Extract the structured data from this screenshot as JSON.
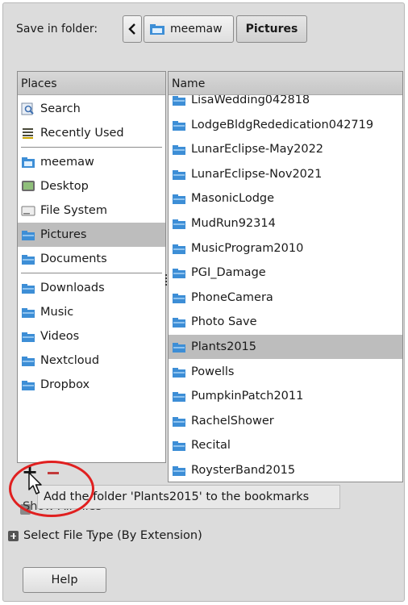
{
  "header": {
    "save_in_label": "Save in folder:",
    "path": [
      {
        "label": "meemaw",
        "icon": "home-folder-icon"
      },
      {
        "label": "Pictures",
        "icon": null
      }
    ]
  },
  "places": {
    "header": "Places",
    "groups": [
      [
        {
          "label": "Search",
          "icon": "search-icon"
        },
        {
          "label": "Recently Used",
          "icon": "recent-icon"
        }
      ],
      [
        {
          "label": "meemaw",
          "icon": "home-folder-icon"
        },
        {
          "label": "Desktop",
          "icon": "desktop-icon"
        },
        {
          "label": "File System",
          "icon": "drive-icon"
        },
        {
          "label": "Pictures",
          "icon": "folder-icon",
          "selected": true
        },
        {
          "label": "Documents",
          "icon": "folder-icon"
        }
      ],
      [
        {
          "label": "Downloads",
          "icon": "folder-icon"
        },
        {
          "label": "Music",
          "icon": "folder-icon"
        },
        {
          "label": "Videos",
          "icon": "folder-icon"
        },
        {
          "label": "Nextcloud",
          "icon": "folder-icon"
        },
        {
          "label": "Dropbox",
          "icon": "folder-icon"
        }
      ]
    ]
  },
  "files": {
    "header": "Name",
    "items": [
      {
        "name": "LisaWedding042818"
      },
      {
        "name": "LodgeBldgRededication042719"
      },
      {
        "name": "LunarEclipse-May2022"
      },
      {
        "name": "LunarEclipse-Nov2021"
      },
      {
        "name": "MasonicLodge"
      },
      {
        "name": "MudRun92314"
      },
      {
        "name": "MusicProgram2010"
      },
      {
        "name": "PGI_Damage"
      },
      {
        "name": "PhoneCamera"
      },
      {
        "name": "Photo Save"
      },
      {
        "name": "Plants2015",
        "selected": true
      },
      {
        "name": "Powells"
      },
      {
        "name": "PumpkinPatch2011"
      },
      {
        "name": "RachelShower"
      },
      {
        "name": "Recital"
      },
      {
        "name": "RoysterBand2015"
      }
    ]
  },
  "toolbar": {
    "add_symbol": "+",
    "tooltip": "Add the folder 'Plants2015' to the bookmarks"
  },
  "options": {
    "show_all_files": "Show All Files",
    "select_file_type": "Select File Type (By Extension)"
  },
  "footer": {
    "help_label": "Help"
  }
}
